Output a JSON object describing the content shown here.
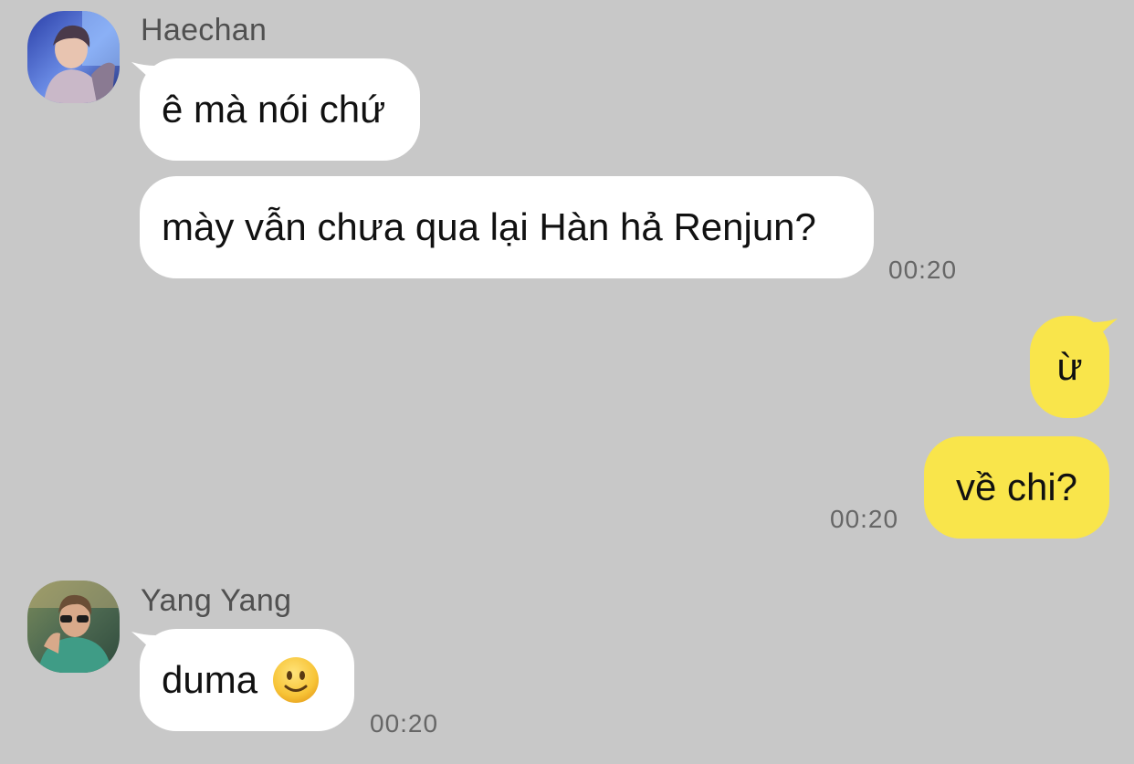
{
  "colors": {
    "background": "#c8c8c8",
    "incoming_bubble": "#ffffff",
    "outgoing_bubble": "#f9e54b",
    "sender_name": "#505050",
    "timestamp": "#666666"
  },
  "messages": {
    "haechan": {
      "sender": "Haechan",
      "avatar_icon": "haechan-avatar",
      "line1": "ê mà nói chứ",
      "line2": "mày vẫn chưa qua lại Hàn hả Renjun?",
      "time": "00:20"
    },
    "me": {
      "line1": "ừ",
      "line2": "về chi?",
      "time": "00:20"
    },
    "yangyang": {
      "sender": "Yang Yang",
      "avatar_icon": "yangyang-avatar",
      "line1": "duma",
      "emoji": "slightly-smiling-face-icon",
      "time": "00:20"
    }
  }
}
